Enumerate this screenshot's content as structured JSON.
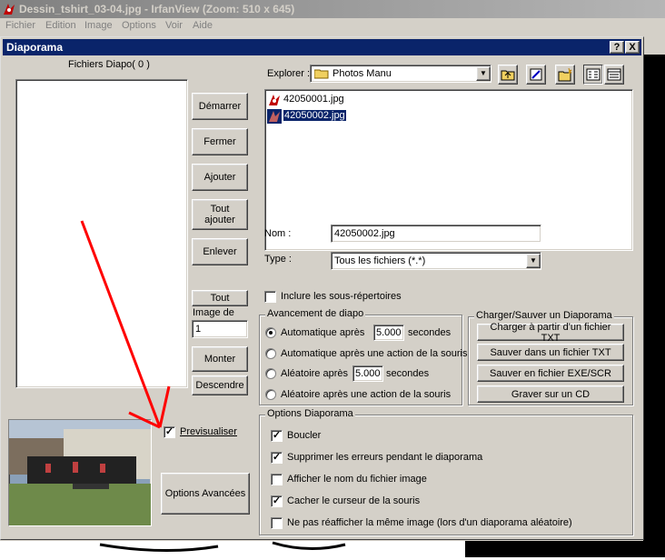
{
  "app": {
    "title": "Dessin_tshirt_03-04.jpg - IrfanView (Zoom: 510 x 645)",
    "menu": [
      "Fichier",
      "Edition",
      "Image",
      "Options",
      "Voir",
      "Aide"
    ]
  },
  "dialog": {
    "title": "Diaporama",
    "help_label": "?",
    "close_label": "X"
  },
  "left": {
    "files_label": "Fichiers Diapo( 0 )",
    "buttons": {
      "start": "Démarrer",
      "close": "Fermer",
      "add": "Ajouter",
      "add_all_1": "Tout",
      "add_all_2": "ajouter",
      "remove": "Enlever",
      "remove_all": "Tout",
      "up": "Monter",
      "down": "Descendre",
      "advanced": "Options Avancées"
    },
    "image_of_label": "Image de",
    "image_of_value": "1",
    "preview_label": "Previsualiser",
    "preview_checked": true
  },
  "explorer": {
    "label": "Explorer :",
    "folder": "Photos Manu",
    "files": [
      {
        "name": "42050001.jpg",
        "selected": false
      },
      {
        "name": "42050002.jpg",
        "selected": true
      }
    ],
    "name_label": "Nom :",
    "name_value": "42050002.jpg",
    "type_label": "Type :",
    "type_value": "Tous les fichiers (*.*)",
    "include_subdirs": "Inclure les sous-répertoires",
    "include_subdirs_checked": false
  },
  "advance": {
    "title": "Avancement de diapo",
    "options": [
      {
        "label": "Automatique après",
        "value": "5.000",
        "suffix": "secondes",
        "selected": true
      },
      {
        "label": "Automatique après une action de la souris",
        "selected": false
      },
      {
        "label": "Aléatoire après",
        "value": "5.000",
        "suffix": "secondes",
        "selected": false
      },
      {
        "label": "Aléatoire  après une action de la souris",
        "selected": false
      }
    ]
  },
  "load_save": {
    "title": "Charger/Sauver un Diaporama",
    "buttons": [
      "Charger à partir d'un fichier TXT",
      "Sauver dans  un fichier TXT",
      "Sauver en  fichier EXE/SCR",
      "Graver sur un CD"
    ]
  },
  "options": {
    "title": "Options Diaporama",
    "items": [
      {
        "label": "Boucler",
        "checked": true
      },
      {
        "label": "Supprimer les erreurs pendant le diaporama",
        "checked": true
      },
      {
        "label": "Afficher le nom du fichier image",
        "checked": false
      },
      {
        "label": "Cacher le curseur de la souris",
        "checked": true
      },
      {
        "label": "Ne pas réafficher la même image (lors d'un diaporama aléatoire)",
        "checked": false
      }
    ]
  },
  "colors": {
    "titlebar_active": "#0a246a",
    "titlebar_inactive": "#808080",
    "face": "#d4d0c8",
    "selection": "#0a246a",
    "arrow": "#ff0000"
  }
}
